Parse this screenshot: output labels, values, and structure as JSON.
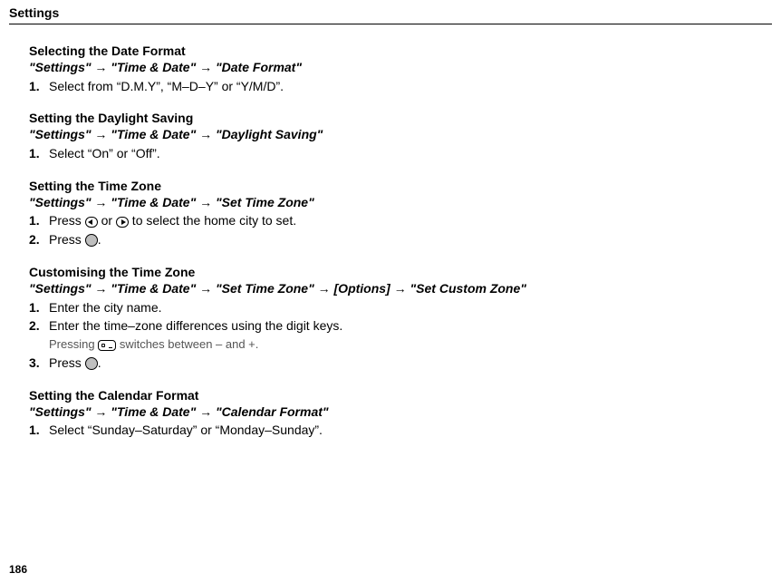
{
  "header": {
    "title": "Settings"
  },
  "page_number": "186",
  "arrow_glyph": "→",
  "sections": [
    {
      "title": "Selecting the Date Format",
      "path": [
        "\"Settings\"",
        "\"Time & Date\"",
        "\"Date Format\""
      ],
      "steps": [
        {
          "num": "1.",
          "text": "Select from “D.M.Y”, “M–D–Y” or “Y/M/D”."
        }
      ]
    },
    {
      "title": "Setting the Daylight Saving",
      "path": [
        "\"Settings\"",
        "\"Time & Date\"",
        "\"Daylight Saving\""
      ],
      "steps": [
        {
          "num": "1.",
          "text": "Select “On” or “Off”."
        }
      ]
    },
    {
      "title": "Setting the Time Zone",
      "path": [
        "\"Settings\"",
        "\"Time & Date\"",
        "\"Set Time Zone\""
      ],
      "steps": [
        {
          "num": "1.",
          "pre": "Press ",
          "icon1": "left",
          "mid": " or ",
          "icon2": "right",
          "post": " to select the home city to set."
        },
        {
          "num": "2.",
          "pre": "Press ",
          "icon1": "circle",
          "post": "."
        }
      ]
    },
    {
      "title": "Customising the Time Zone",
      "path": [
        "\"Settings\"",
        "\"Time & Date\"",
        "\"Set Time Zone\"",
        "[Options]",
        "\"Set Custom Zone\""
      ],
      "steps": [
        {
          "num": "1.",
          "text": "Enter the city name."
        },
        {
          "num": "2.",
          "text": "Enter the time–zone differences using the digit keys.",
          "sub": {
            "pre": "Pressing ",
            "icon": "key",
            "post": " switches between – and +."
          }
        },
        {
          "num": "3.",
          "pre": "Press ",
          "icon1": "circle",
          "post": "."
        }
      ]
    },
    {
      "title": "Setting the Calendar Format",
      "path": [
        "\"Settings\"",
        "\"Time & Date\"",
        "\"Calendar Format\""
      ],
      "steps": [
        {
          "num": "1.",
          "text": "Select “Sunday–Saturday” or “Monday–Sunday”."
        }
      ]
    }
  ]
}
